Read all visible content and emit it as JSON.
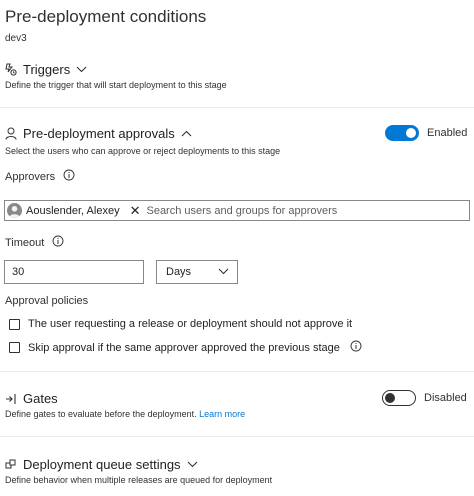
{
  "header": {
    "title": "Pre-deployment conditions",
    "stage": "dev3"
  },
  "triggers": {
    "title": "Triggers",
    "description": "Define the trigger that will start deployment to this stage",
    "icon": "trigger-icon"
  },
  "approvals": {
    "title": "Pre-deployment approvals",
    "description": "Select the users who can approve or reject deployments to this stage",
    "toggle_label": "Enabled",
    "enabled": true,
    "approvers_label": "Approvers",
    "approvers": [
      {
        "name": "Aouslender, Alexey"
      }
    ],
    "search_placeholder": "Search users and groups for approvers",
    "timeout_label": "Timeout",
    "timeout_value": "30",
    "timeout_unit": "Days",
    "policies_label": "Approval policies",
    "policies": [
      {
        "label": "The user requesting a release or deployment should not approve it",
        "checked": false
      },
      {
        "label": "Skip approval if the same approver approved the previous stage",
        "checked": false
      }
    ]
  },
  "gates": {
    "title": "Gates",
    "description": "Define gates to evaluate before the deployment.",
    "learn_more": "Learn more",
    "toggle_label": "Disabled",
    "enabled": false
  },
  "queue": {
    "title": "Deployment queue settings",
    "description": "Define behavior when multiple releases are queued for deployment"
  },
  "colors": {
    "accent": "#0078d4",
    "text": "#201f1e",
    "border": "#8a8886"
  }
}
